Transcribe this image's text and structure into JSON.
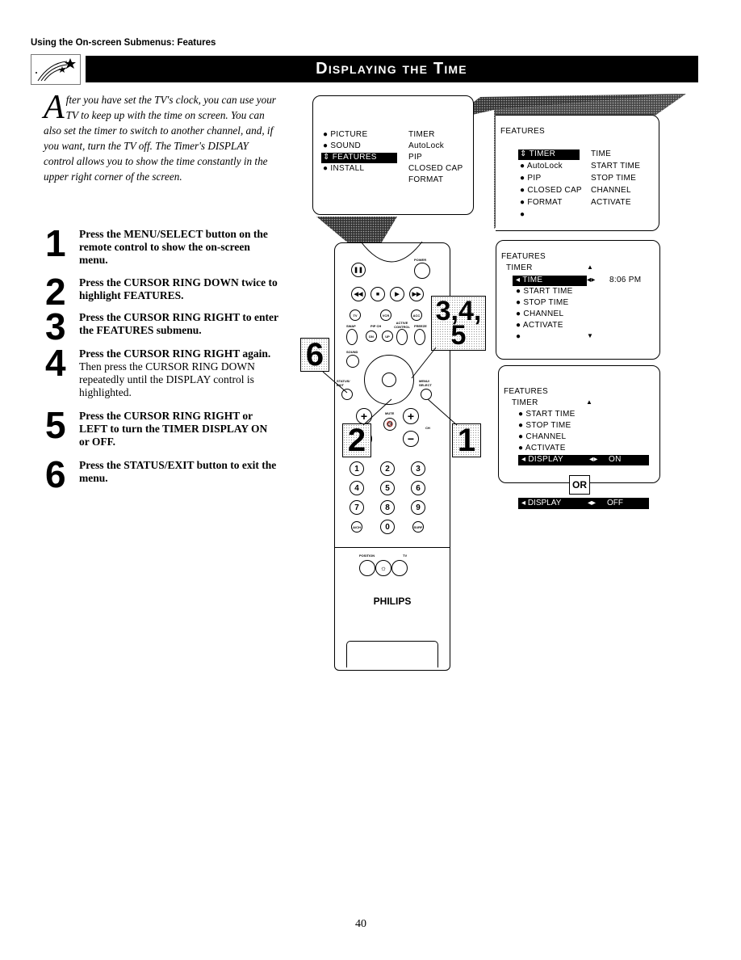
{
  "header": {
    "section_title": "Using the On-screen Submenus: Features",
    "banner_title": "Displaying the Time",
    "icon": "shooting-star-icon"
  },
  "intro": {
    "drop_cap": "A",
    "text": "fter you have set the TV's clock, you can use your TV to keep up with the time on screen. You can also set the timer to switch to another channel, and, if you want, turn the TV off. The Timer's DISPLAY control allows you to show the time constantly in the upper right corner of the screen."
  },
  "steps": [
    {
      "num": "1",
      "bold": "Press the MENU/SELECT button on the remote control to show the on-screen menu.",
      "normal": ""
    },
    {
      "num": "2",
      "bold": "Press the CURSOR RING DOWN twice to highlight FEATURES.",
      "normal": ""
    },
    {
      "num": "3",
      "bold": "Press the CURSOR RING RIGHT to enter the FEATURES submenu.",
      "normal": ""
    },
    {
      "num": "4",
      "bold": "Press the CURSOR RING RIGHT again.",
      "normal": " Then press the CURSOR RING DOWN repeatedly until the DISPLAY control is highlighted."
    },
    {
      "num": "5",
      "bold": "Press the CURSOR RING RIGHT or LEFT to turn the TIMER DISPLAY ON or OFF.",
      "normal": ""
    },
    {
      "num": "6",
      "bold": "Press the STATUS/EXIT button to exit the menu.",
      "normal": ""
    }
  ],
  "screen_main": {
    "left": [
      "PICTURE",
      "SOUND",
      "FEATURES",
      "INSTALL"
    ],
    "selected": "FEATURES",
    "right": [
      "TIMER",
      "AutoLock",
      "PIP",
      "CLOSED CAP",
      "FORMAT"
    ]
  },
  "screen_features": {
    "title": "FEATURES",
    "left": [
      "TIMER",
      "AutoLock",
      "PIP",
      "CLOSED CAP",
      "FORMAT",
      ""
    ],
    "selected": "TIMER",
    "right": [
      "TIME",
      "START TIME",
      "STOP TIME",
      "CHANNEL",
      "ACTIVATE"
    ]
  },
  "screen_timer": {
    "title": "FEATURES",
    "subtitle": "TIMER",
    "items": [
      "TIME",
      "START TIME",
      "STOP TIME",
      "CHANNEL",
      "ACTIVATE",
      ""
    ],
    "selected": "TIME",
    "value": "8:06 PM"
  },
  "screen_display": {
    "title": "FEATURES",
    "subtitle": "TIMER",
    "items": [
      "START TIME",
      "STOP TIME",
      "CHANNEL",
      "ACTIVATE"
    ],
    "selected_label": "DISPLAY",
    "selected_value": "ON",
    "or_label": "OR",
    "alt_label": "DISPLAY",
    "alt_value": "OFF"
  },
  "remote": {
    "brand": "PHILIPS",
    "power_label": "POWER",
    "transport": [
      "pause",
      "rewind",
      "stop",
      "play",
      "fast-forward"
    ],
    "row_labels": [
      "TV",
      "VCR",
      "ACC"
    ],
    "mid_labels": [
      "SWAP",
      "PIP CH",
      "ACTIVE CONTROL",
      "FREEZE"
    ],
    "pip_buttons": [
      "DN",
      "UP"
    ],
    "sound_label": "SOUND",
    "status_label": "STATUS/ EXIT",
    "menu_label": "MENU/ SELECT",
    "mute_label": "MUTE",
    "ch_label": "CH",
    "digits": [
      "1",
      "2",
      "3",
      "4",
      "5",
      "6",
      "7",
      "8",
      "9",
      "A/CH",
      "0",
      "SURF"
    ],
    "bottom_labels": [
      "POSITION",
      "TV"
    ]
  },
  "callouts": [
    "1",
    "2",
    "3,4,\n5",
    "6"
  ],
  "page_number": "40"
}
